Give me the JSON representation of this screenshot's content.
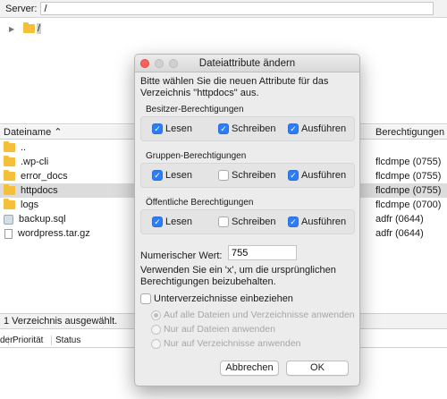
{
  "server_bar": {
    "label": "Server:",
    "value": "/"
  },
  "tree": {
    "root_label": "/"
  },
  "list": {
    "col_name": "Dateiname",
    "col_name_sort": "⌃",
    "col_perms": "Berechtigungen",
    "rows": [
      {
        "name": "..",
        "perm": "",
        "icon": "folder-icon"
      },
      {
        "name": ".wp-cli",
        "perm": "flcdmpe (0755)",
        "icon": "folder-icon"
      },
      {
        "name": "error_docs",
        "perm": "flcdmpe (0755)",
        "icon": "folder-icon"
      },
      {
        "name": "httpdocs",
        "perm": "flcdmpe (0755)",
        "icon": "folder-icon",
        "selected": true
      },
      {
        "name": "logs",
        "perm": "flcdmpe (0700)",
        "icon": "folder-icon"
      },
      {
        "name": "backup.sql",
        "perm": "adfr (0644)",
        "icon": "database-file-icon"
      },
      {
        "name": "wordpress.tar.gz",
        "perm": "adfr (0644)",
        "icon": "file-icon"
      }
    ]
  },
  "status": {
    "text": "1 Verzeichnis ausgewählt."
  },
  "queue": {
    "col_server": "der",
    "col_priority": "Priorität",
    "col_status": "Status"
  },
  "dialog": {
    "title": "Dateiattribute ändern",
    "intro": "Bitte wählen Sie die neuen Attribute für das Verzeichnis \"httpdocs\" aus.",
    "owner": {
      "title": "Besitzer-Berechtigungen",
      "read": "Lesen",
      "write": "Schreiben",
      "execute": "Ausführen",
      "read_checked": true,
      "write_checked": true,
      "execute_checked": true
    },
    "group": {
      "title": "Gruppen-Berechtigungen",
      "read": "Lesen",
      "write": "Schreiben",
      "execute": "Ausführen",
      "read_checked": true,
      "write_checked": false,
      "execute_checked": true
    },
    "public": {
      "title": "Öffentliche Berechtigungen",
      "read": "Lesen",
      "write": "Schreiben",
      "execute": "Ausführen",
      "read_checked": true,
      "write_checked": false,
      "execute_checked": true
    },
    "numeric_label": "Numerischer Wert:",
    "numeric_value": "755",
    "explain": "Verwenden Sie ein 'x', um die ursprünglichen Berechtigungen beizubehalten.",
    "recurse_label": "Unterverzeichnisse einbeziehen",
    "recurse_checked": false,
    "radio_all": "Auf alle Dateien und Verzeichnisse anwenden",
    "radio_files": "Nur auf Dateien anwenden",
    "radio_dirs": "Nur auf Verzeichnisse anwenden",
    "cancel_label": "Abbrechen",
    "ok_label": "OK"
  },
  "colors": {
    "accent": "#2d7df6",
    "close": "#fc605c",
    "folder": "#f6bf3a"
  }
}
